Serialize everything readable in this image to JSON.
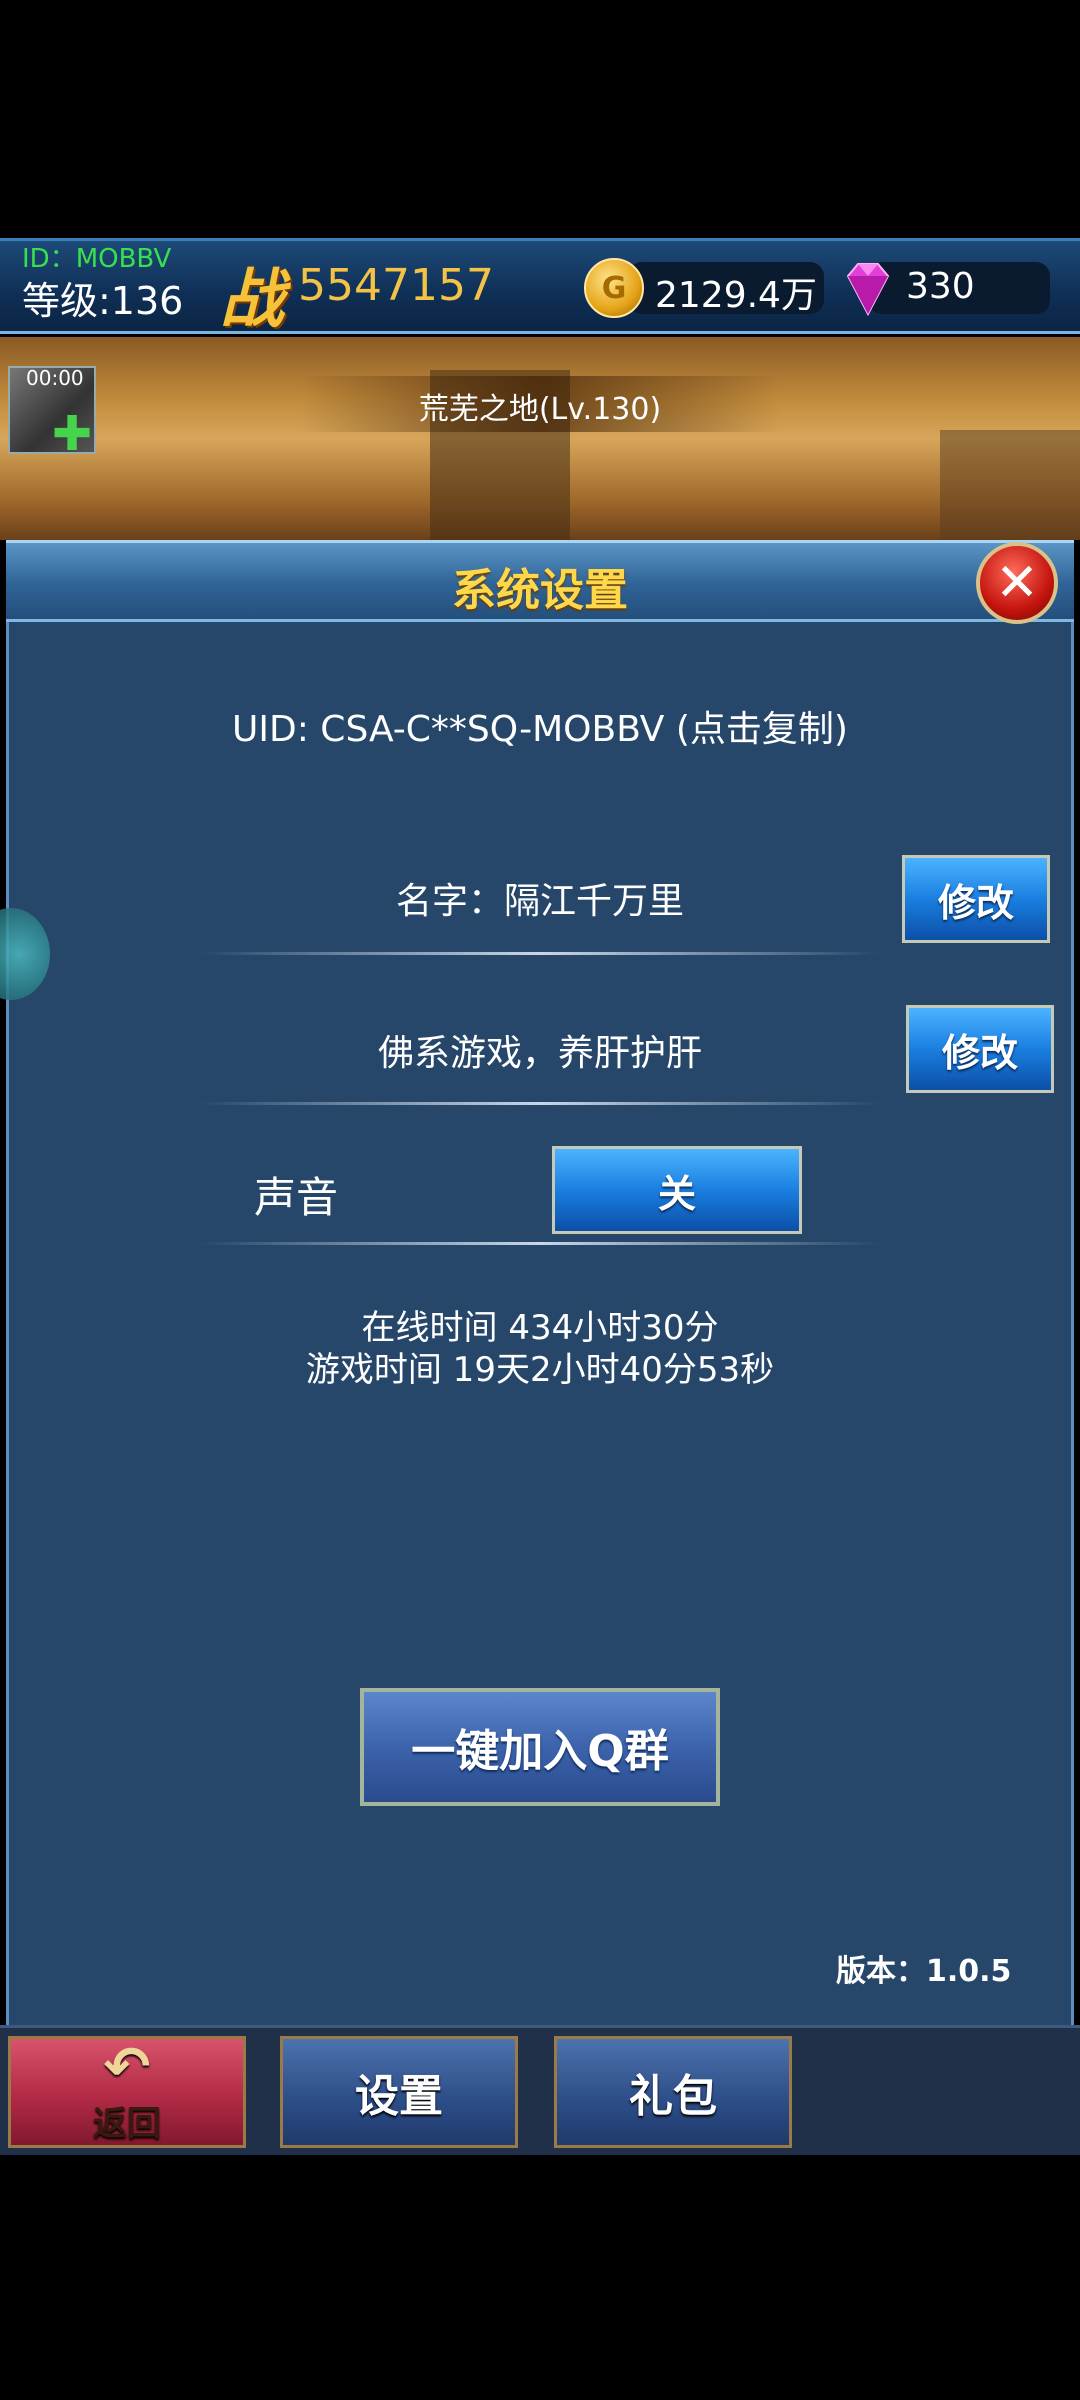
{
  "topbar": {
    "id_text": "ID：MOBBV",
    "level_text": "等级:136",
    "power_glyph": "战",
    "power_value": "5547157",
    "gold_icon_letter": "G",
    "gold_value": "2129.4万",
    "gem_value": "330",
    "icons": [
      "gold-coin-icon",
      "diamond-icon"
    ]
  },
  "banner": {
    "map_title": "荒芜之地(Lv.130)",
    "buff_timer": "00:00",
    "buff_plus": "✚"
  },
  "panel": {
    "title": "系统设置",
    "close_glyph": "✕",
    "uid_text": "UID: CSA-C**SQ-MOBBV (点击复制)",
    "name_text": "名字：隔江千万里",
    "edit_label": "修改",
    "motto_text": "佛系游戏，养肝护肝",
    "edit_label_2": "修改",
    "sound_label": "声音",
    "sound_toggle": "关",
    "online_time": "在线时间 434小时30分",
    "game_time": "游戏时间 19天2小时40分53秒",
    "qq_button": "一键加入Q群",
    "version": "版本：1.0.5"
  },
  "bottom_tabs": {
    "back_arrow": "↶",
    "back_label": "返回",
    "settings": "设置",
    "gift": "礼包"
  },
  "colors": {
    "panel_bg": "#26476a",
    "title_gold": "#ffd84a",
    "power_gold": "#f4c245",
    "id_green": "#39e04d",
    "button_blue": "#1a7fe0",
    "back_red": "#b22a45"
  }
}
